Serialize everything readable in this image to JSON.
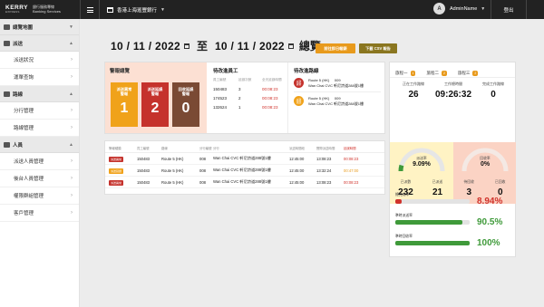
{
  "header": {
    "brand": "KERRY",
    "brand_sub": "EXPRESS",
    "brand_text_1": "銀行服務專線",
    "brand_text_2": "Banking Services",
    "store": "香港上海滙豐銀行",
    "user": "AdminName",
    "avatar": "A",
    "logout": "登出"
  },
  "sidebar": {
    "groups": [
      {
        "label": "總覽地圖",
        "items": []
      },
      {
        "label": "派送",
        "items": [
          "派送狀況",
          "運單查詢"
        ]
      },
      {
        "label": "路線",
        "items": [
          "分行管理",
          "路線管理"
        ]
      },
      {
        "label": "人員",
        "items": [
          "派送人員管理",
          "後台人員管理",
          "權限群組管理",
          "客戶管理"
        ]
      }
    ]
  },
  "dates": {
    "from": "10 / 11 / 2022",
    "to_word": "至",
    "to": "10 / 11 / 2022",
    "overview": "總覽"
  },
  "buttons": {
    "today": "前往即日報錶",
    "download": "下載 CSV 報告"
  },
  "alerts": {
    "title": "警報總覽",
    "boxes": [
      {
        "label": "派送異常\n警報",
        "value": "1"
      },
      {
        "label": "派送延誤\n警報",
        "value": "2"
      },
      {
        "label": "回收延誤\n警報",
        "value": "0"
      }
    ]
  },
  "staff": {
    "title": "待改進員工",
    "headers": [
      "員工編號",
      "延誤次數",
      "全天延誤時間"
    ],
    "rows": [
      [
        "150483",
        "3",
        "00:08:23"
      ],
      [
        "174523",
        "2",
        "00:08:23"
      ],
      [
        "132624",
        "1",
        "00:08:23"
      ]
    ]
  },
  "routes": {
    "title": "待改進路線",
    "items": [
      {
        "badge": "派送\n異常",
        "line1": "Route 5 (HK)     009",
        "line2": "Wan Chai CVC 軒尼詩道288號1樓"
      },
      {
        "badge": "派送\n延誤",
        "line1": "Route 5 (HK)     009",
        "line2": "Wan Chai CVC 軒尼詩道288號1樓"
      }
    ]
  },
  "table": {
    "headers": [
      "警報種類",
      "員工編號",
      "路線",
      "分行編號",
      "分行",
      "派送時間段",
      "實際派送時間",
      "延誤時間"
    ],
    "rows": [
      {
        "badge": "派送異常",
        "emp": "150483",
        "route": "Route 5 (HK)",
        "code": "008",
        "branch": "Wan Chai CVC 軒尼詩道288號1樓",
        "slot": "12:45:00",
        "actual": "13:08:23",
        "delay": "00:08:23"
      },
      {
        "badge": "派送延誤",
        "emp": "150483",
        "route": "Route 5 (HK)",
        "code": "008",
        "branch": "Wan Chai CVC 軒尼詩道288號1樓",
        "slot": "12:45:00",
        "actual": "13:32:24",
        "delay": "00:47:00"
      },
      {
        "badge": "派送異常",
        "emp": "150483",
        "route": "Route 5 (HK)",
        "code": "008",
        "branch": "Wan Chai CVC 軒尼詩道288號1樓",
        "slot": "12:45:00",
        "actual": "13:08:23",
        "delay": "00:08:23"
      }
    ]
  },
  "panel": {
    "tabs": [
      {
        "label": "旅程一",
        "count": "1"
      },
      {
        "label": "旅程二",
        "count": "2"
      },
      {
        "label": "旅程三",
        "count": "2"
      }
    ],
    "summary": [
      {
        "label": "正在工作路線",
        "value": "26"
      },
      {
        "label": "工作總時間",
        "value": "09:26:32"
      },
      {
        "label": "完成工作路線",
        "value": "0"
      }
    ],
    "gauge_left": {
      "label": "派送率",
      "value": "9.09%",
      "fraction": 0.09,
      "sub": [
        {
          "label": "已派數",
          "value": "232"
        },
        {
          "label": "已派送",
          "value": "21"
        }
      ]
    },
    "gauge_right": {
      "label": "回收率",
      "value": "0%",
      "fraction": 0,
      "sub": [
        {
          "label": "待回收",
          "value": "3"
        },
        {
          "label": "已回收",
          "value": "0"
        }
      ]
    },
    "bars": [
      {
        "label": "總完成率",
        "value": "8.94%",
        "fraction": 0.09,
        "color": "red"
      },
      {
        "label": "準時派送率",
        "value": "90.5%",
        "fraction": 0.905,
        "color": "green"
      },
      {
        "label": "準時回收率",
        "value": "100%",
        "fraction": 1.0,
        "color": "green"
      }
    ]
  }
}
